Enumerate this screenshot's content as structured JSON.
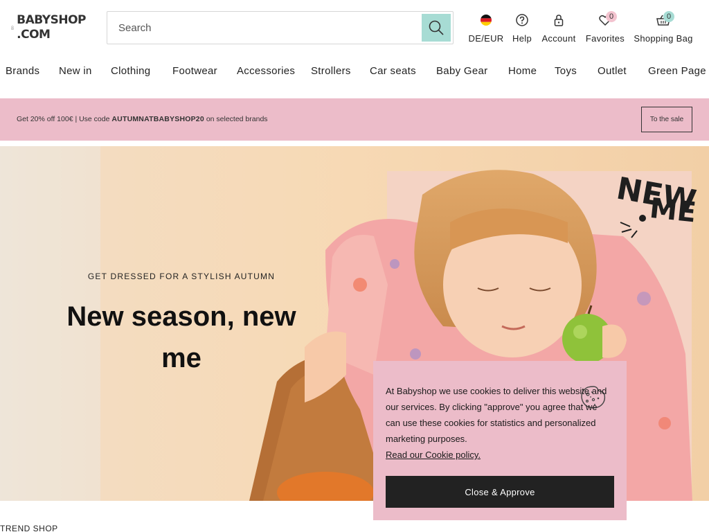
{
  "header": {
    "logo_line1": "BABYSHOP",
    "logo_line2": ".COM",
    "search": {
      "placeholder": "Search"
    },
    "utils": {
      "locale": "DE/EUR",
      "help": "Help",
      "account": "Account",
      "favorites": "Favorites",
      "favorites_count": "0",
      "bag": "Shopping Bag",
      "bag_count": "0"
    }
  },
  "nav": {
    "items": [
      "Brands",
      "New in",
      "Clothing",
      "Footwear",
      "Accessories",
      "Strollers",
      "Car seats",
      "Baby Gear",
      "Home",
      "Toys",
      "Outlet",
      "Green Page"
    ]
  },
  "promo": {
    "text_prefix": "Get 20% off 100€  | Use code",
    "code": "AUTUMNATBABYSHOP20",
    "text_suffix": "on selected brands",
    "button": "To the sale"
  },
  "hero": {
    "kicker": "GET DRESSED FOR A STYLISH AUTUMN",
    "title": "New season, new me",
    "overlay_line1": "NEW",
    "overlay_line2": "ME"
  },
  "cookie": {
    "text": "At Babyshop we use cookies to deliver this website and our services. By clicking \"approve\" you agree that we can use these cookies for statistics and personalized marketing purposes.",
    "link": "Read our Cookie policy.",
    "button": "Close & Approve"
  },
  "section": {
    "title": "TREND SHOP"
  },
  "colors": {
    "pink": "#ecbcc9",
    "mint": "#a7dcd4",
    "dark": "#222222"
  }
}
